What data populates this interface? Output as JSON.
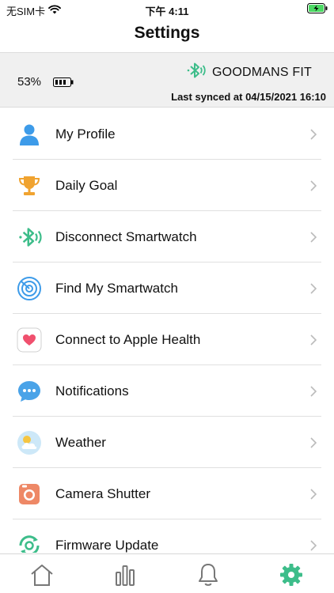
{
  "status_bar": {
    "carrier": "无SIM卡",
    "time": "下午 4:11",
    "icons": [
      "wifi-icon",
      "battery-charging-icon"
    ]
  },
  "header": {
    "title": "Settings"
  },
  "device": {
    "battery_percent": "53%",
    "battery_level": 0.53,
    "name": "GOODMANS FIT",
    "last_synced": "Last synced at 04/15/2021 16:10",
    "icon": "bluetooth-icon",
    "accent_color": "#3dbd8a"
  },
  "menu": {
    "items": [
      {
        "label": "My Profile",
        "icon": "profile-icon"
      },
      {
        "label": "Daily Goal",
        "icon": "trophy-icon"
      },
      {
        "label": "Disconnect Smartwatch",
        "icon": "bluetooth-icon"
      },
      {
        "label": "Find My Smartwatch",
        "icon": "radar-icon"
      },
      {
        "label": "Connect to Apple Health",
        "icon": "health-heart-icon"
      },
      {
        "label": "Notifications",
        "icon": "chat-bubble-icon"
      },
      {
        "label": "Weather",
        "icon": "weather-icon"
      },
      {
        "label": "Camera Shutter",
        "icon": "camera-icon"
      },
      {
        "label": "Firmware Update",
        "icon": "firmware-update-icon"
      }
    ]
  },
  "tab_bar": {
    "tabs": [
      "home-icon",
      "stats-icon",
      "notifications-icon",
      "settings-icon"
    ],
    "active": "settings-icon",
    "active_color": "#3dbd8a"
  }
}
